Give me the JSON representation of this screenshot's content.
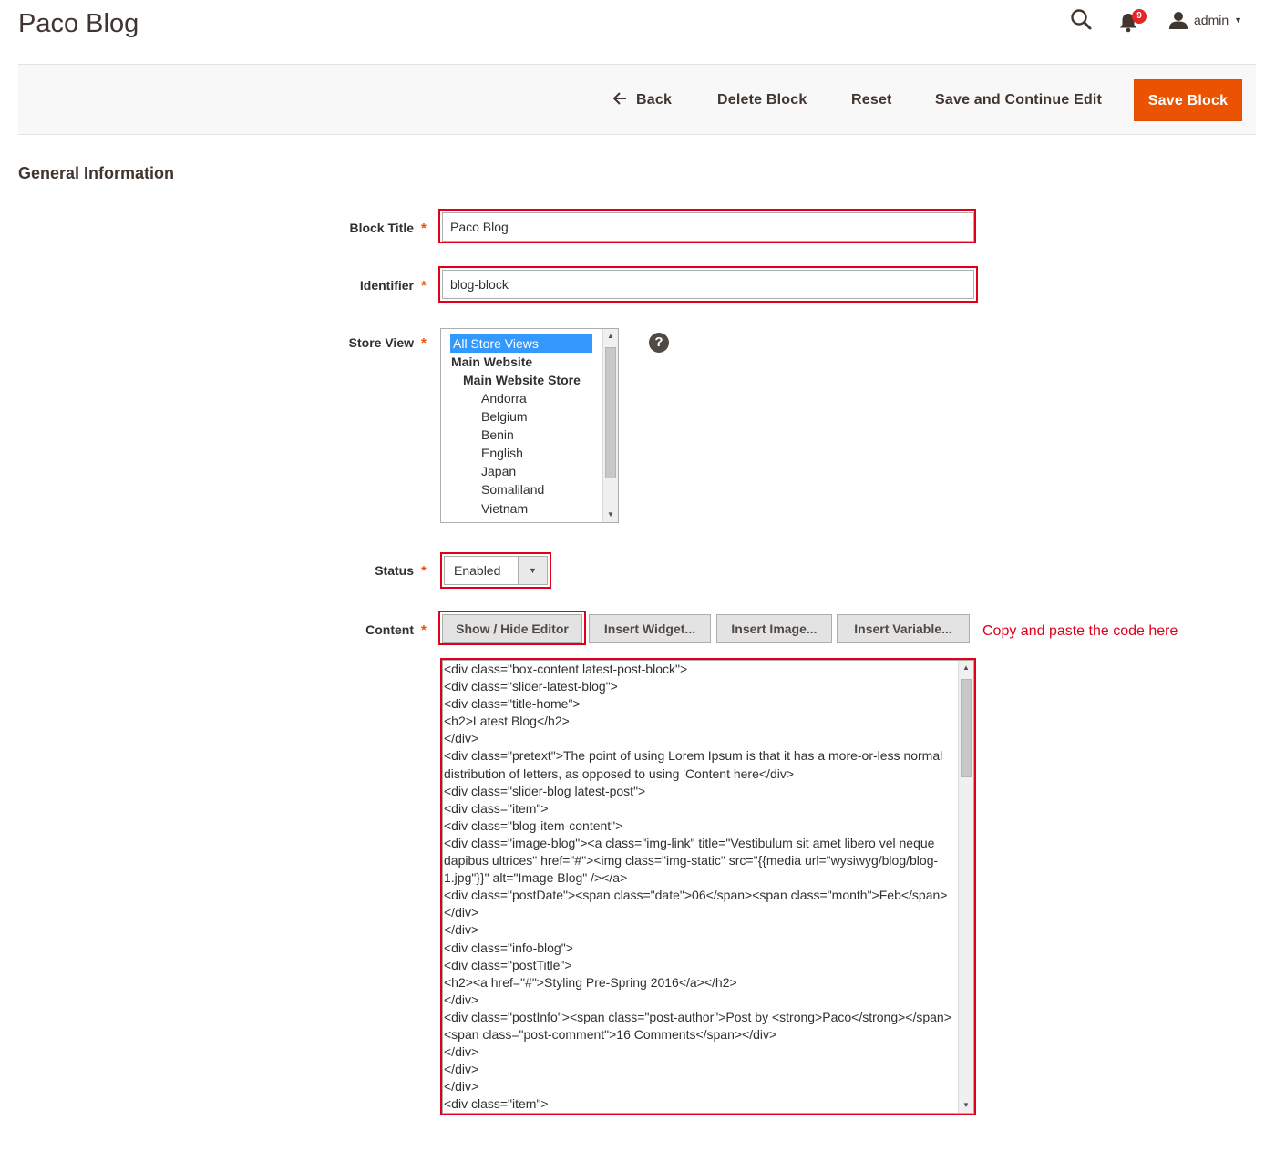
{
  "header": {
    "title": "Paco Blog",
    "notifications_count": "9",
    "user_name": "admin",
    "icons": {
      "search": "search-icon",
      "bell": "bell-icon",
      "user": "user-icon",
      "caret": "caret-down-icon"
    }
  },
  "actions": {
    "back": "Back",
    "delete": "Delete Block",
    "reset": "Reset",
    "save_continue": "Save and Continue Edit",
    "save": "Save Block"
  },
  "section_title": "General Information",
  "form": {
    "block_title": {
      "label": "Block Title",
      "value": "Paco Blog"
    },
    "identifier": {
      "label": "Identifier",
      "value": "blog-block"
    },
    "store_view": {
      "label": "Store View",
      "options": [
        "All Store Views",
        "Main Website",
        "Main Website Store",
        "Andorra",
        "Belgium",
        "Benin",
        "English",
        "Japan",
        "Somaliland",
        "Vietnam"
      ],
      "selected": "All Store Views"
    },
    "status": {
      "label": "Status",
      "value": "Enabled"
    },
    "content": {
      "label": "Content",
      "buttons": {
        "show_hide": "Show / Hide Editor",
        "insert_widget": "Insert Widget...",
        "insert_image": "Insert Image...",
        "insert_variable": "Insert Variable..."
      },
      "note": "Copy and paste the code here",
      "code": "<div class=\"box-content latest-post-block\">\n<div class=\"slider-latest-blog\">\n<div class=\"title-home\">\n<h2>Latest Blog</h2>\n</div>\n<div class=\"pretext\">The point of using Lorem Ipsum is that it has a more-or-less normal distribution of letters, as opposed to using 'Content here</div>\n<div class=\"slider-blog latest-post\">\n<div class=\"item\">\n<div class=\"blog-item-content\">\n<div class=\"image-blog\"><a class=\"img-link\" title=\"Vestibulum sit amet libero vel neque dapibus ultrices\" href=\"#\"><img class=\"img-static\" src=\"{{media url=\"wysiwyg/blog/blog-1.jpg\"}}\" alt=\"Image Blog\" /></a>\n<div class=\"postDate\"><span class=\"date\">06</span><span class=\"month\">Feb</span></div>\n</div>\n<div class=\"info-blog\">\n<div class=\"postTitle\">\n<h2><a href=\"#\">Styling Pre-Spring 2016</a></h2>\n</div>\n<div class=\"postInfo\"><span class=\"post-author\">Post by <strong>Paco</strong></span><span class=\"post-comment\">16 Comments</span></div>\n</div>\n</div>\n</div>\n<div class=\"item\">"
    }
  },
  "colors": {
    "accent": "#eb5202",
    "highlight": "#e0001b",
    "selected": "#3399ff"
  }
}
